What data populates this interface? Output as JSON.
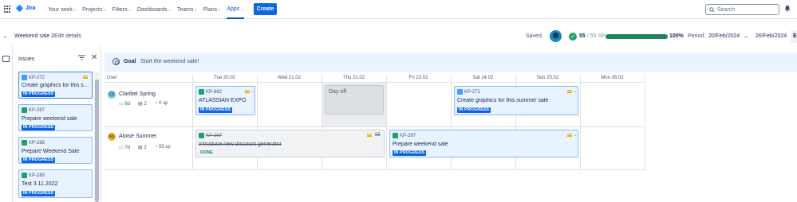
{
  "nav": {
    "product": "Jira",
    "items": [
      {
        "label": "Your work",
        "chev": "⌄"
      },
      {
        "label": "Projects",
        "chev": "⌄"
      },
      {
        "label": "Filters",
        "chev": "⌄"
      },
      {
        "label": "Dashboards",
        "chev": "⌄"
      },
      {
        "label": "Teams",
        "chev": "⌄"
      },
      {
        "label": "Plans",
        "chev": "⌄"
      },
      {
        "label": "Apps",
        "chev": "⌄"
      }
    ],
    "create": "Create",
    "search_placeholder": "Search"
  },
  "header": {
    "back": "←",
    "title": "Weekend sale 2",
    "edit": "Edit details",
    "saved": "Saved",
    "done_sp": "55",
    "total_sp": "/ 55 SP",
    "progress": 1.0,
    "percent": "100%",
    "period_label": "Period:",
    "start": "20/Feb/2024",
    "arrow": "→",
    "end": "26/Feb/2024",
    "extra": "E"
  },
  "issues_panel": {
    "title": "Issues",
    "cards": [
      {
        "key": "KP-272",
        "type": "task",
        "title": "Create graphics for this sum...",
        "status": "IN PROGRESS"
      },
      {
        "key": "KP-287",
        "type": "story",
        "title": "Prepare weekend sale",
        "status": "IN PROGRESS"
      },
      {
        "key": "KP-288",
        "type": "story",
        "title": "Prepare Weekend Sale",
        "status": "IN PROGRESS"
      },
      {
        "key": "KP-289",
        "type": "story",
        "title": "Test 3.11.2022",
        "status": "IN PROGRESS"
      }
    ]
  },
  "goal": {
    "label": "Goal",
    "text": "Start the weekend sale!"
  },
  "calendar": {
    "user_header": "User",
    "days": [
      "Tue 20.02",
      "Wed 21.02",
      "Thu 22.02",
      "Fri 23.02",
      "Sat 24.02",
      "Sun 25.02",
      "Mon 26.02"
    ],
    "day_off": "Day off",
    "users": [
      {
        "initials": "CS",
        "name": "Claribel Spring",
        "days": "8d",
        "issues": "2",
        "sp": "0 sp",
        "color": "#6cc3e0"
      },
      {
        "initials": "AS",
        "name": "Aloise Summer",
        "days": "7d",
        "issues": "2",
        "sp": "55 sp",
        "color": "#f5a623"
      }
    ],
    "cards": [
      {
        "key": "KP-682",
        "type": "story",
        "title": "ATLASSIAN EXPO",
        "status": "IN PROGRESS"
      },
      {
        "key": "KP-272",
        "type": "task",
        "title": "Create graphics for this summer sale",
        "status": "IN PROGRESS"
      },
      {
        "key": "KP-297",
        "type": "story",
        "title": "Introduce new discount generator",
        "status": "DONE",
        "sp": "55"
      },
      {
        "key": "KP-287",
        "type": "story",
        "title": "Prepare weekend sale",
        "status": "IN PROGRESS"
      }
    ]
  }
}
